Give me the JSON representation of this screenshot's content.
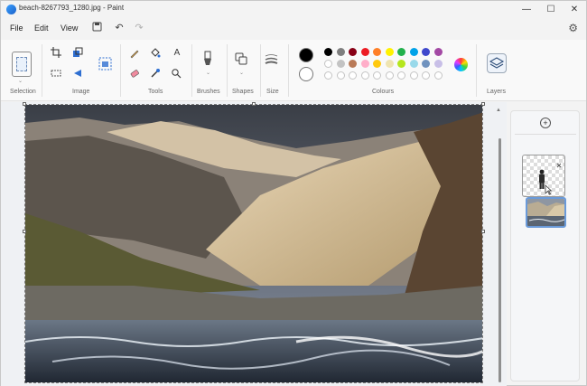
{
  "window": {
    "title": "beach-8267793_1280.jpg - Paint",
    "minimize": "—",
    "maximize": "☐",
    "close": "✕"
  },
  "menu": {
    "file": "File",
    "edit": "Edit",
    "view": "View",
    "save_icon": "save-icon",
    "undo_icon": "undo-icon",
    "redo_icon": "redo-icon",
    "settings_icon": "gear-icon"
  },
  "ribbon": {
    "groups": {
      "selection": "Selection",
      "image": "Image",
      "tools": "Tools",
      "brushes": "Brushes",
      "shapes": "Shapes",
      "size": "Size",
      "colours": "Colours",
      "layers": "Layers"
    },
    "primary_color": "#000000",
    "secondary_color": "#ffffff",
    "palette_row1": [
      "#000000",
      "#7f7f7f",
      "#880015",
      "#ed1c24",
      "#ff7f27",
      "#fff200",
      "#22b14c",
      "#00a2e8",
      "#3f48cc",
      "#a349a4"
    ],
    "palette_row2": [
      "#ffffff",
      "#c3c3c3",
      "#b97a57",
      "#ffaec9",
      "#ffc90e",
      "#efe4b0",
      "#b5e61d",
      "#99d9ea",
      "#7092be",
      "#c8bfe7"
    ],
    "palette_row3_count": 10
  },
  "layers_panel": {
    "add_label": "+"
  }
}
